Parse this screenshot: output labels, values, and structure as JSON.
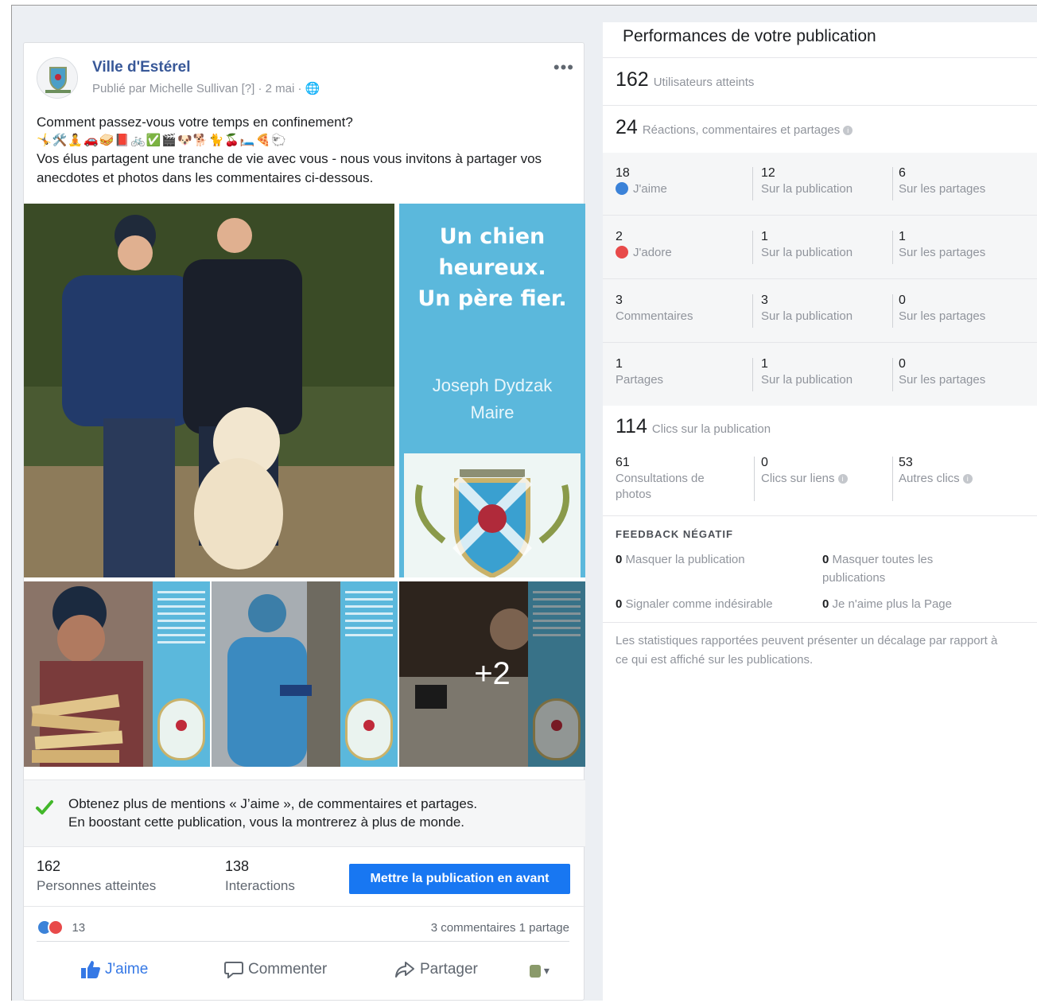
{
  "post": {
    "page_name": "Ville d'Estérel",
    "meta": "Publié par Michelle Sullivan [?] · 2 mai · ",
    "text_line1": "Comment passez-vous votre temps en confinement?",
    "emoji_row": "🤸🛠️🧘🚗🥪📕🚲✅🎬🐶🐕🐈🍒🛏️🍕🐑",
    "text_line2": "Vos élus partagent une tranche de vie avec vous - nous vous invitons à partager vos anecdotes et photos dans les commentaires ci-dessous.",
    "poster_title_lines": [
      "Un chien",
      "heureux.",
      "Un père fier."
    ],
    "poster_name": "Joseph Dydzak",
    "poster_role": "Maire",
    "more_photos": "+2",
    "boost_title": "Obtenez plus de mentions « J’aime », de commentaires et partages.",
    "boost_sub": "En boostant cette publication, vous la montrerez à plus de monde.",
    "reach_value": "162",
    "reach_label": "Personnes atteintes",
    "interactions_value": "138",
    "interactions_label": "Interactions",
    "boost_button": "Mettre la publication en avant",
    "reaction_count": "13",
    "comments_shares": "3 commentaires  1 partage",
    "actions": {
      "like": "J'aime",
      "comment": "Commenter",
      "share": "Partager"
    }
  },
  "panel": {
    "title": "Performances de votre publication",
    "reach_big": "162",
    "reach_label": "Utilisateurs atteints",
    "reactions_big": "24",
    "reactions_label": "Réactions, commentaires et partages",
    "rows": [
      {
        "total": "18",
        "label": "J'aime",
        "on_post": "12",
        "on_post_label": "Sur la publication",
        "on_shares": "6",
        "on_shares_label": "Sur les partages"
      },
      {
        "total": "2",
        "label": "J'adore",
        "on_post": "1",
        "on_post_label": "Sur la publication",
        "on_shares": "1",
        "on_shares_label": "Sur les partages"
      },
      {
        "total": "3",
        "label": "Commentaires",
        "on_post": "3",
        "on_post_label": "Sur la publication",
        "on_shares": "0",
        "on_shares_label": "Sur les partages"
      },
      {
        "total": "1",
        "label": "Partages",
        "on_post": "1",
        "on_post_label": "Sur la publication",
        "on_shares": "0",
        "on_shares_label": "Sur les partages"
      }
    ],
    "clicks_big": "114",
    "clicks_label": "Clics sur la publication",
    "photo_views": "61",
    "photo_views_label_1": "Consultations de",
    "photo_views_label_2": "photos",
    "link_clicks": "0",
    "link_clicks_label": "Clics sur liens",
    "other_clicks": "53",
    "other_clicks_label": "Autres clics",
    "negative_title": "FEEDBACK NÉGATIF",
    "hide_post_n": "0",
    "hide_post": "Masquer la publication",
    "hide_all_n": "0",
    "hide_all_1": "Masquer toutes les",
    "hide_all_2": "publications",
    "spam_n": "0",
    "spam": "Signaler comme indésirable",
    "unlike_n": "0",
    "unlike": "Je n'aime plus la Page",
    "footnote": "Les statistiques rapportées peuvent présenter un décalage par rapport à ce qui est affiché sur les publications."
  },
  "colors": {
    "link_blue": "#385898",
    "button_blue": "#1877f2",
    "poster_blue": "#5bb8dc",
    "love_red": "#e84a4a",
    "like_blue": "#3b82d8"
  }
}
